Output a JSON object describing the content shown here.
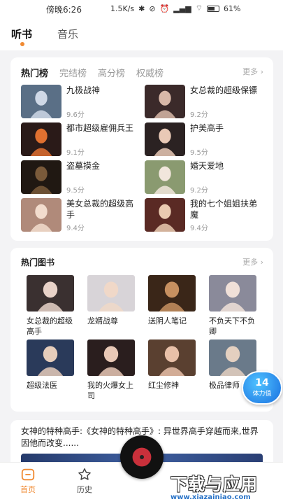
{
  "status_bar": {
    "time": "傍晚6:26",
    "speed": "1.5K/s",
    "battery": "61%"
  },
  "top_tabs": [
    {
      "label": "听书",
      "active": true
    },
    {
      "label": "音乐",
      "active": false
    }
  ],
  "ranking": {
    "tabs": [
      "热门榜",
      "完结榜",
      "高分榜",
      "权威榜"
    ],
    "more": "更多",
    "items": [
      {
        "title": "九极战神",
        "score": "9.6分",
        "cover_colors": [
          "#5a6f86",
          "#cfd8e6"
        ]
      },
      {
        "title": "女总裁的超级保镖",
        "score": "9.2分",
        "cover_colors": [
          "#3b2a2a",
          "#d8b8a8"
        ]
      },
      {
        "title": "都市超级雇佣兵王",
        "score": "9.1分",
        "cover_colors": [
          "#2a1a18",
          "#e07030"
        ]
      },
      {
        "title": "护美高手",
        "score": "9.5分",
        "cover_colors": [
          "#2b2222",
          "#e9c9b6"
        ]
      },
      {
        "title": "盗墓摸金",
        "score": "9.5分",
        "cover_colors": [
          "#201812",
          "#7a5a3a"
        ]
      },
      {
        "title": "婚天爱地",
        "score": "9.2分",
        "cover_colors": [
          "#8a9a70",
          "#f1e6dc"
        ]
      },
      {
        "title": "美女总裁的超级高手",
        "score": "9.4分",
        "cover_colors": [
          "#b08a7a",
          "#f2dccd"
        ]
      },
      {
        "title": "我的七个姐姐扶弟魔",
        "score": "9.4分",
        "cover_colors": [
          "#5a2a24",
          "#e9cab0"
        ]
      }
    ]
  },
  "hot_books": {
    "title": "热门图书",
    "more": "更多",
    "items": [
      {
        "title": "女总裁的超级高手",
        "cover_colors": [
          "#3a3030",
          "#e8d2c8"
        ]
      },
      {
        "title": "龙婿战尊",
        "cover_colors": [
          "#d8d4d8",
          "#f0d8c8"
        ]
      },
      {
        "title": "送阴人笔记",
        "cover_colors": [
          "#3a2618",
          "#c79060"
        ]
      },
      {
        "title": "不负天下不负卿",
        "cover_colors": [
          "#8a8a9a",
          "#f0e0d8"
        ]
      },
      {
        "title": "超级法医",
        "cover_colors": [
          "#2a3a5a",
          "#e6cdbb"
        ]
      },
      {
        "title": "我的火爆女上司",
        "cover_colors": [
          "#2a1e1e",
          "#e8c8b6"
        ]
      },
      {
        "title": "红尘修神",
        "cover_colors": [
          "#5a4030",
          "#e8c0a8"
        ]
      },
      {
        "title": "极品律师",
        "cover_colors": [
          "#6a7a8a",
          "#e4d0c0"
        ]
      }
    ]
  },
  "stamina": {
    "value": "14",
    "label": "体力值"
  },
  "promo": {
    "text": "女神的特种高手:《女神的特种高手》: 异世界高手穿越而来,世界因他而改变......"
  },
  "bottom_nav": [
    {
      "label": "首页",
      "active": true,
      "icon": "home-icon"
    },
    {
      "label": "历史",
      "active": false,
      "icon": "star-icon"
    }
  ],
  "watermark": {
    "big": "下载与应用",
    "small": "www.xiazainiao.com"
  }
}
